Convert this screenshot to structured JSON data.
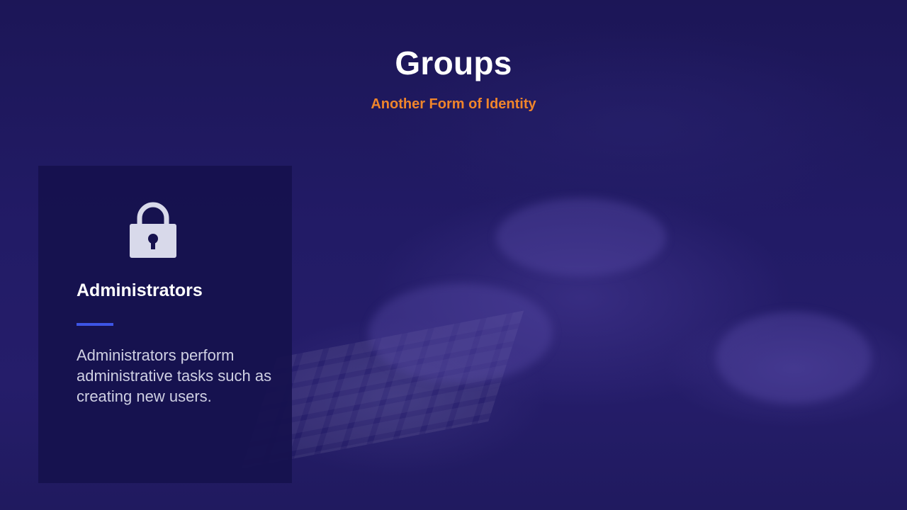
{
  "slide": {
    "title": "Groups",
    "subtitle": "Another Form of Identity",
    "background_color": "#1f1a5e"
  },
  "card": {
    "icon": "lock-icon",
    "title": "Administrators",
    "description": "Administrators perform administrative tasks such as creating new users.",
    "accent_color": "#3d55e6"
  },
  "colors": {
    "subtitle": "#f0852b",
    "title": "#ffffff"
  }
}
